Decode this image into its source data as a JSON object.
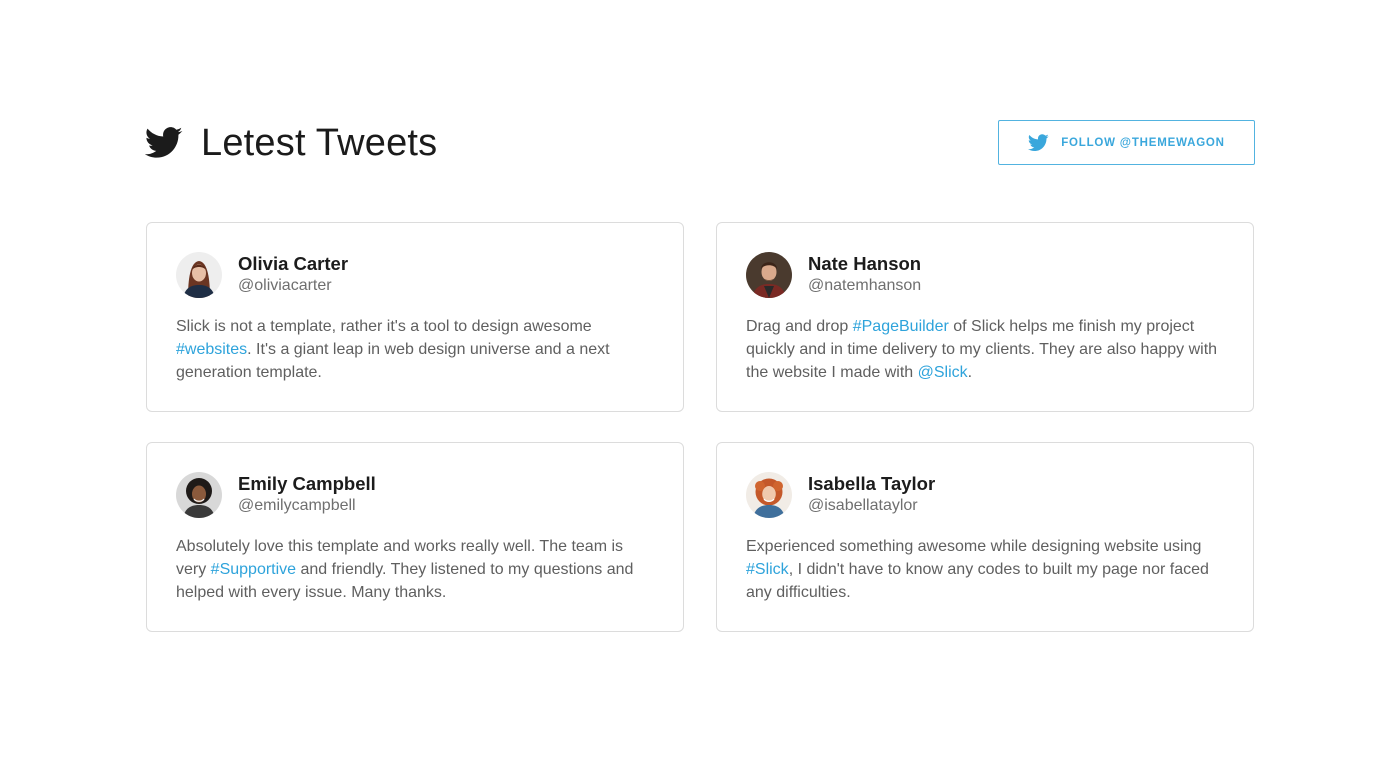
{
  "header": {
    "title": "Letest Tweets",
    "brand_icon": "twitter-bird-icon",
    "follow_button_label": "FOLLOW @THEMEWAGON",
    "follow_button_icon": "twitter-bird-icon"
  },
  "colors": {
    "accent": "#2ea3db",
    "card_border": "#dcdcdc",
    "title_text": "#1b1b1b",
    "body_text": "#5f5f5f"
  },
  "tweets": [
    {
      "name": "Olivia Carter",
      "handle": "@oliviacarter",
      "text_1": "Slick is not a template, rather it's a tool to design awesome ",
      "tag_1": "#websites",
      "text_2": ". It's a giant leap in web design universe and a next generation template.",
      "tag_2": "",
      "text_3": ""
    },
    {
      "name": "Nate Hanson",
      "handle": "@natemhanson",
      "text_1": "Drag and drop ",
      "tag_1": "#PageBuilder",
      "text_2": " of Slick helps me finish my project quickly and in time delivery to my clients. They are also happy with the website I made with ",
      "tag_2": "@Slick",
      "text_3": "."
    },
    {
      "name": "Emily Campbell",
      "handle": "@emilycampbell",
      "text_1": "Absolutely love this template and works really well. The team is very ",
      "tag_1": "#Supportive",
      "text_2": " and friendly. They listened to my questions and helped with every issue. Many thanks.",
      "tag_2": "",
      "text_3": ""
    },
    {
      "name": "Isabella Taylor",
      "handle": "@isabellataylor",
      "text_1": "Experienced something awesome while designing website using ",
      "tag_1": "#Slick",
      "text_2": ", I didn't have to know any codes to built my page nor faced any difficulties.",
      "tag_2": "",
      "text_3": ""
    }
  ]
}
